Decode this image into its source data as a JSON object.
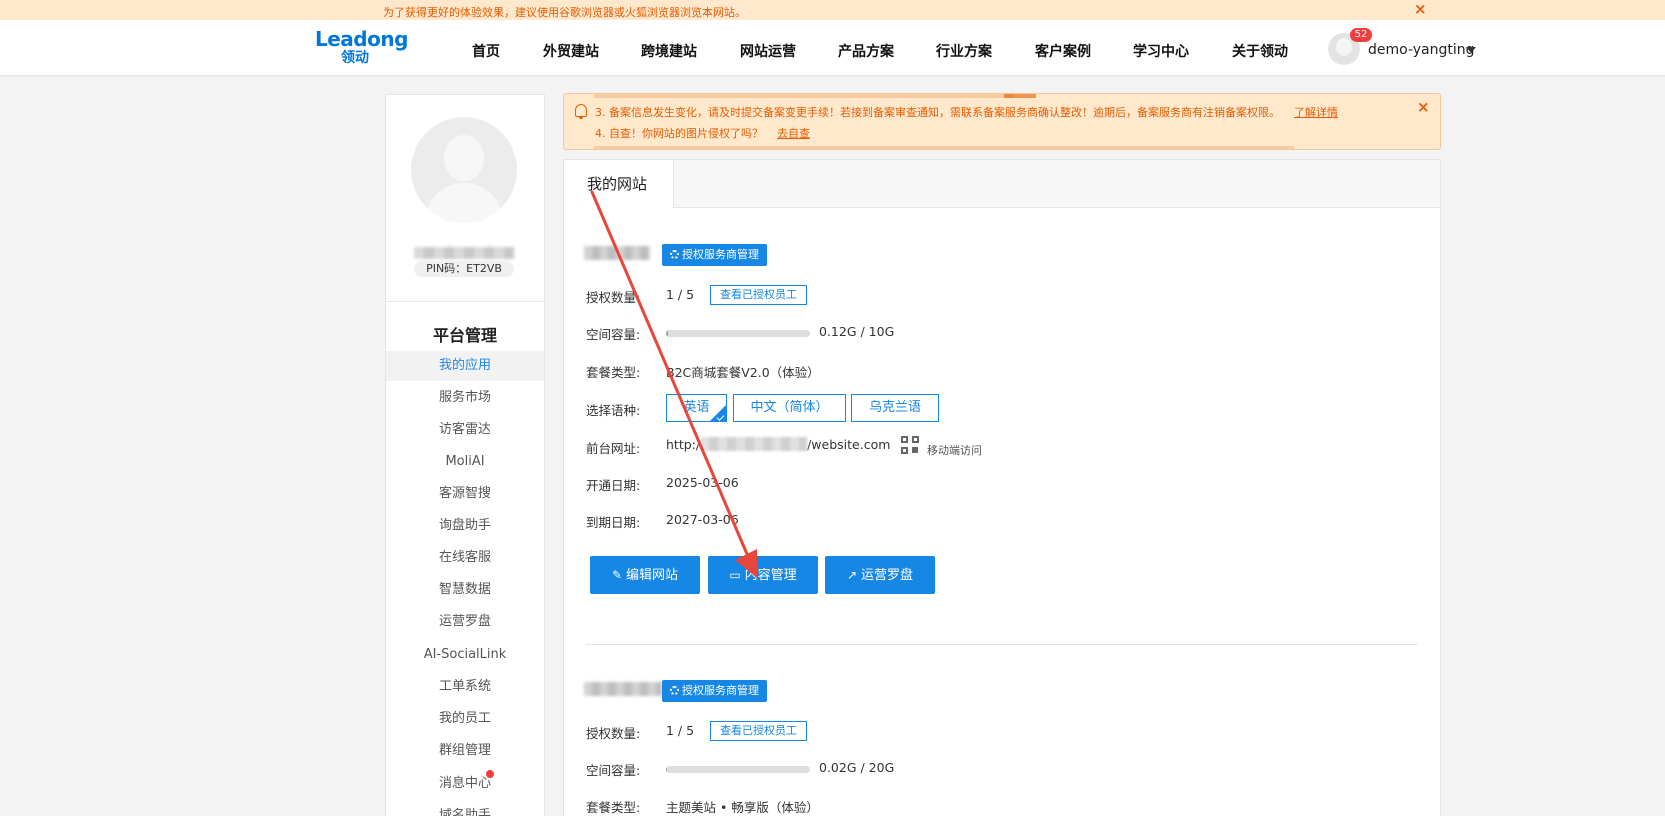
{
  "browser_tip": {
    "text": "为了获得更好的体验效果，建议使用谷歌浏览器或火狐浏览器浏览本网站。",
    "close": "×"
  },
  "header": {
    "logo_en": "Leadong",
    "logo_cn": "领动",
    "nav": [
      "首页",
      "外贸建站",
      "跨境建站",
      "网站运营",
      "产品方案",
      "行业方案",
      "客户案例",
      "学习中心",
      "关于领动"
    ],
    "user": {
      "name": "demo-yangting",
      "badge": "52"
    }
  },
  "sidebar": {
    "pin": "PIN码：ET2VB",
    "section_title": "平台管理",
    "items": [
      "我的应用",
      "服务市场",
      "访客雷达",
      "MoliAI",
      "客源智搜",
      "询盘助手",
      "在线客服",
      "智慧数据",
      "运营罗盘",
      "AI-SocialLink",
      "工单系统",
      "我的员工",
      "群组管理",
      "消息中心",
      "域名助手"
    ],
    "active_index": 0
  },
  "notice": {
    "line3": "3. 备案信息发生变化，请及时提交备案变更手续！若接到备案审查通知，需联系备案服务商确认整改！逾期后，备案服务商有注销备案权限。",
    "line3_link": "了解详情",
    "line4": "4. 自查！你网站的图片侵权了吗？",
    "line4_link": "去自查",
    "close": "×"
  },
  "panel": {
    "tab": "我的网站",
    "labels": {
      "auth_count": "授权数量:",
      "space": "空间容量:",
      "plan": "套餐类型:",
      "language": "选择语种:",
      "frontend": "前台网址:",
      "open_date": "开通日期:",
      "expire_date": "到期日期:"
    },
    "auth_btn": "授权服务商管理",
    "view_staff_btn": "查看已授权员工",
    "qr_label": "移动端访问",
    "actions": {
      "edit": "编辑网站",
      "content": "内容管理",
      "compass": "运营罗盘"
    },
    "sites": [
      {
        "auth_count": "1 / 5",
        "space_text": "0.12G / 10G",
        "space_ratio": 0.012,
        "plan": "B2C商城套餐V2.0（体验）",
        "languages": [
          "英语",
          "中文（简体）",
          "乌克兰语"
        ],
        "url_prefix": "http:/",
        "url_suffix": "/website.com",
        "open_date": "2025-03-06",
        "expire_date": "2027-03-06"
      },
      {
        "auth_count": "1 / 5",
        "space_text": "0.02G / 20G",
        "space_ratio": 0.001,
        "plan": "主题美站 • 畅享版（体验）"
      }
    ]
  },
  "colors": {
    "primary": "#1787e6",
    "warning": "#e65c00",
    "warning_bg": "#ffe8cc",
    "annotation": "#e8453c"
  }
}
